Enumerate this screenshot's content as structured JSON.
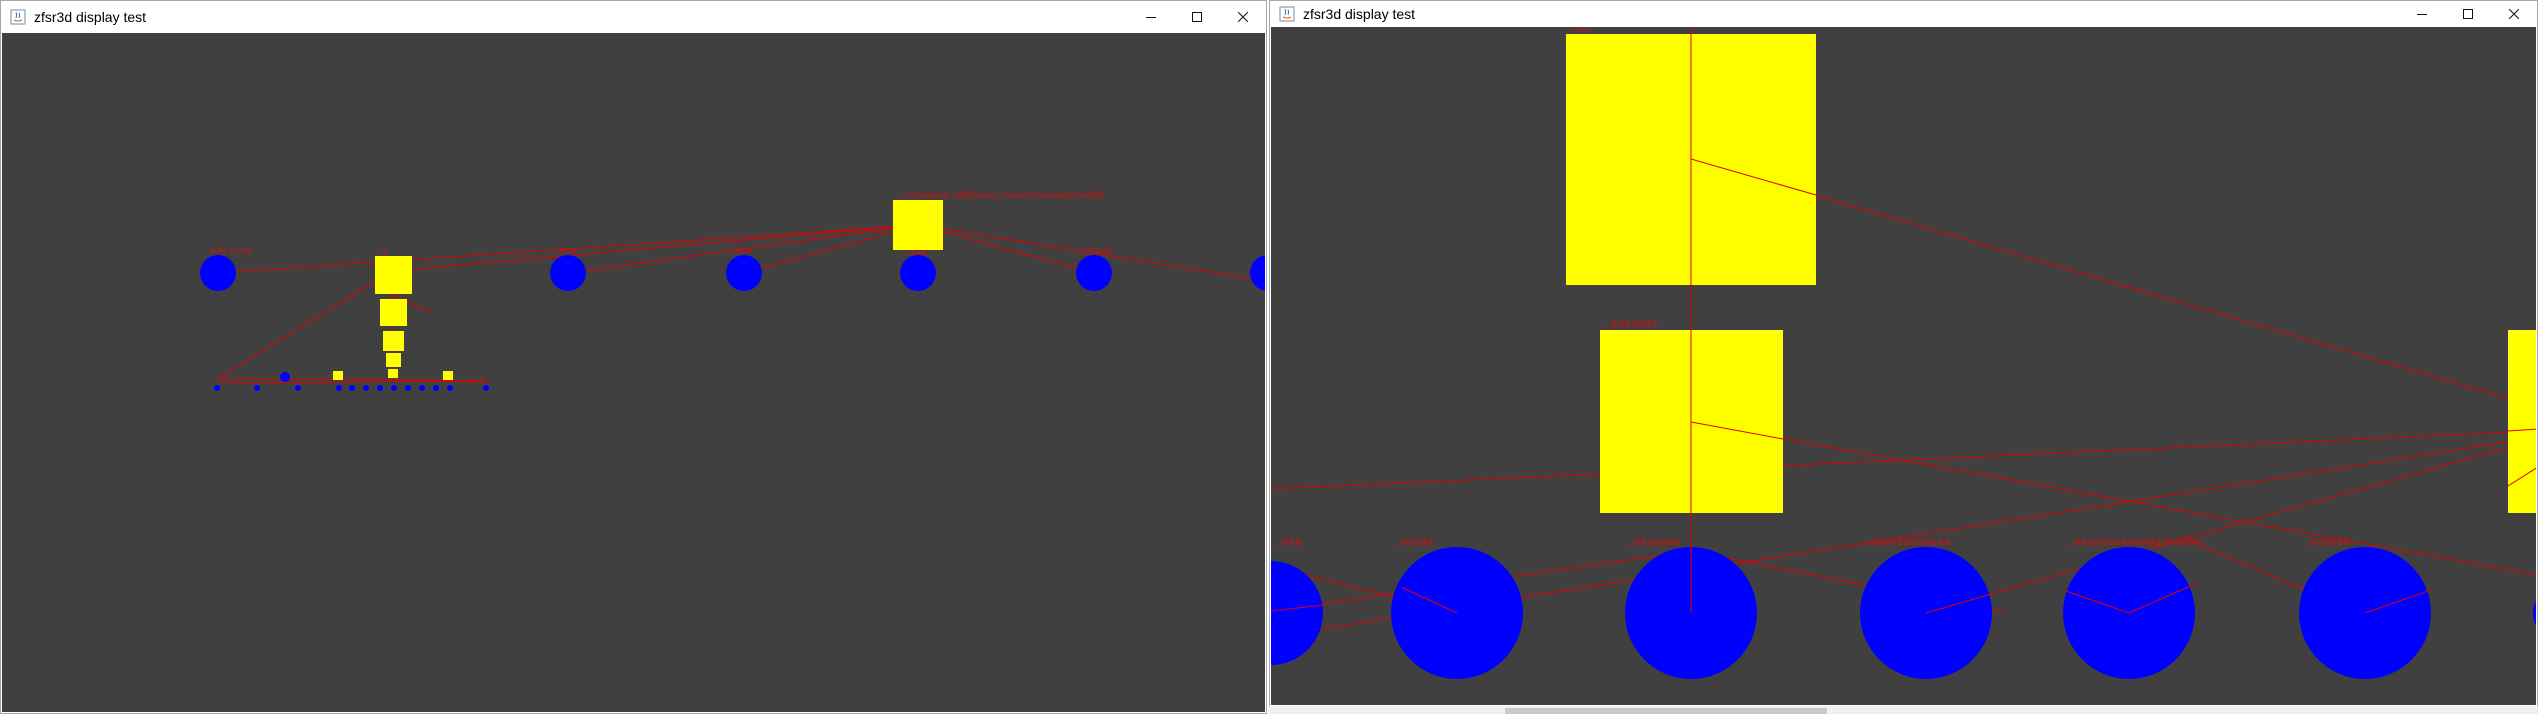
{
  "windows": [
    {
      "title": "zfsr3d display test",
      "controls": {
        "minimize": "minimize-icon",
        "maximize": "maximize-icon",
        "close": "close-icon"
      }
    },
    {
      "title": "zfsr3d display test",
      "controls": {
        "minimize": "minimize-icon",
        "maximize": "maximize-icon",
        "close": "close-icon"
      }
    }
  ],
  "colors": {
    "background": "#404040",
    "dataset_node": "#ffff00",
    "disk_node": "#0000ff",
    "edge": "#e00000",
    "label": "#d01010"
  },
  "left_scene": {
    "pool_label": "...ckbaaaaa.sdkfjaaaa_cheorenaaaaeafrasdfaf",
    "labels": [
      "...aaa.rt.aa",
      "...e",
      "...aaa",
      "...aaa",
      "...aaa",
      "...aaaaa",
      "...b.c",
      "...b.c"
    ]
  },
  "right_scene": {
    "labels": [
      "...b.c",
      "...aaaaaaa",
      "...aaa",
      "...aaaaa",
      "...aaaaaaa",
      "...aaaaaaaaaaaa",
      "...aaaaaaaaaaaaaaaaaaa",
      "...aaaaaa"
    ]
  }
}
